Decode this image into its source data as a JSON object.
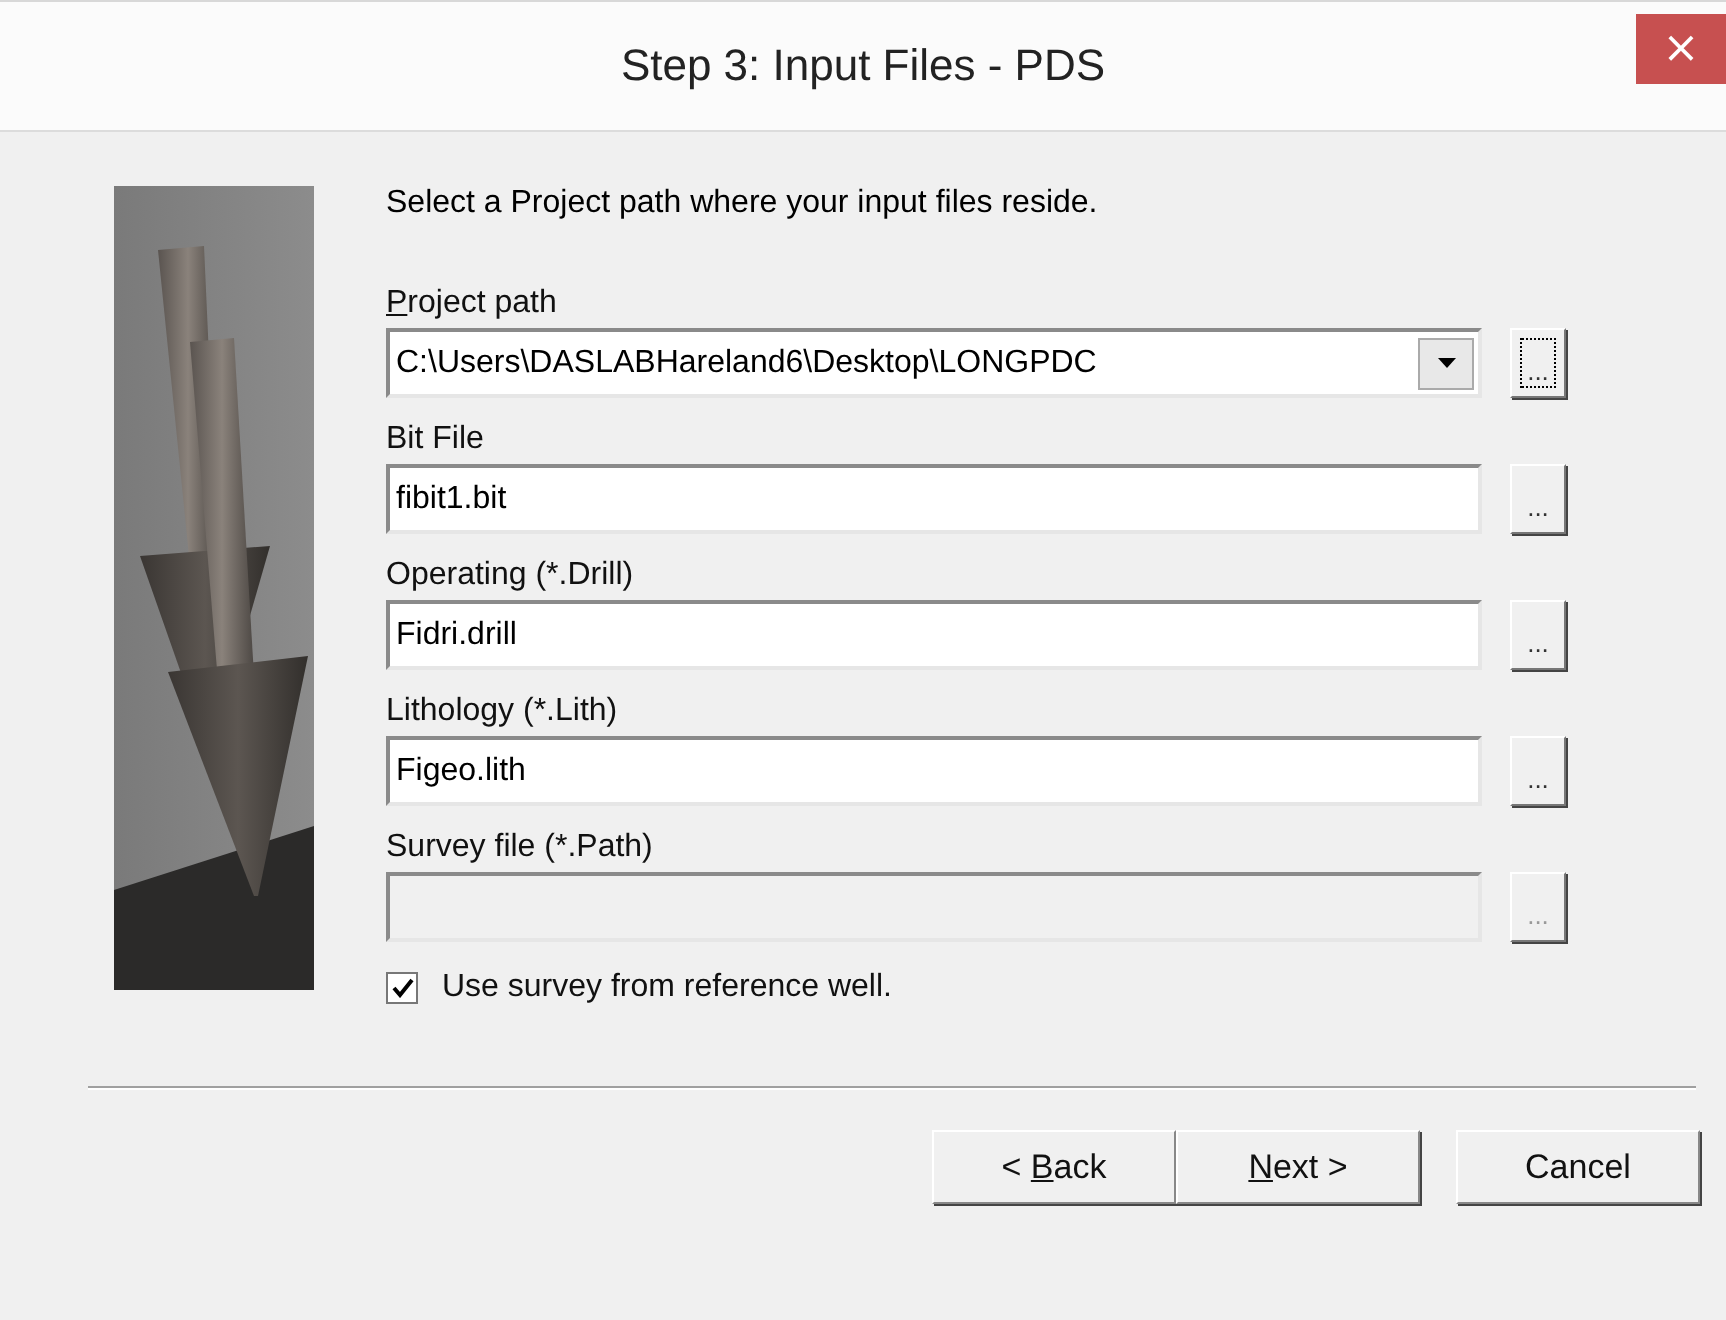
{
  "window": {
    "title": "Step 3: Input Files - PDS",
    "close": "×"
  },
  "intro": "Select a Project path where your input files reside.",
  "fields": [
    {
      "kind": "combo",
      "label": {
        "key": "P",
        "after": "roject path"
      },
      "value": "C:\\Users\\DASLABHareland6\\Desktop\\LONGPDC",
      "browse": {
        "label": "...",
        "focused": true
      }
    },
    {
      "kind": "text",
      "label": "Bit File",
      "value": "fibit1.bit",
      "disabled": false,
      "browse": {
        "label": "...",
        "focused": false
      }
    },
    {
      "kind": "text",
      "label": "Operating (*.Drill)",
      "value": "Fidri.drill",
      "disabled": false,
      "browse": {
        "label": "...",
        "focused": false
      }
    },
    {
      "kind": "text",
      "label": "Lithology (*.Lith)",
      "value": "Figeo.lith",
      "disabled": false,
      "browse": {
        "label": "...",
        "focused": false
      }
    },
    {
      "kind": "text",
      "label": "Survey file (*.Path)",
      "disabled": true,
      "browse": {
        "label": "...",
        "focused": false
      }
    }
  ],
  "checkbox": {
    "label": "Use survey from reference well.",
    "checked": true
  },
  "buttons": [
    {
      "label": {
        "before": "< ",
        "key": "B",
        "after": "ack"
      }
    },
    {
      "label": {
        "key": "N",
        "after": "ext >"
      }
    },
    {
      "label": "Cancel"
    }
  ]
}
